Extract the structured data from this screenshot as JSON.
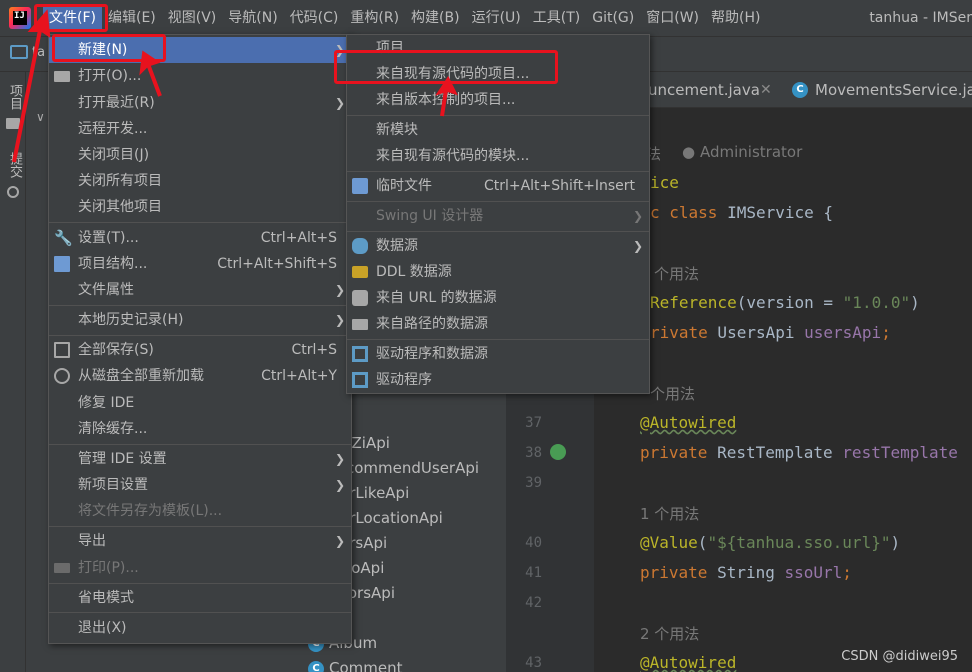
{
  "menubar": {
    "logo_text": "IJ",
    "items": [
      "文件(F)",
      "编辑(E)",
      "视图(V)",
      "导航(N)",
      "代码(C)",
      "重构(R)",
      "构建(B)",
      "运行(U)",
      "工具(T)",
      "Git(G)",
      "窗口(W)",
      "帮助(H)"
    ],
    "title": "tanhua - IMSer"
  },
  "toolbar": {
    "label": "ta"
  },
  "left_strip": {
    "project": "项目",
    "commit": "提交"
  },
  "file_menu": {
    "items": [
      {
        "label": "新建(N)",
        "shortcut": "",
        "submenu": true
      },
      {
        "label": "打开(O)...",
        "shortcut": ""
      },
      {
        "label": "打开最近(R)",
        "shortcut": "",
        "submenu": true
      },
      {
        "label": "远程开发...",
        "shortcut": ""
      },
      {
        "label": "关闭项目(J)",
        "shortcut": ""
      },
      {
        "label": "关闭所有项目",
        "shortcut": ""
      },
      {
        "label": "关闭其他项目",
        "shortcut": ""
      },
      {
        "label": "设置(T)...",
        "shortcut": "Ctrl+Alt+S"
      },
      {
        "label": "项目结构...",
        "shortcut": "Ctrl+Alt+Shift+S"
      },
      {
        "label": "文件属性",
        "shortcut": "",
        "submenu": true
      },
      {
        "label": "本地历史记录(H)",
        "shortcut": "",
        "submenu": true
      },
      {
        "label": "全部保存(S)",
        "shortcut": "Ctrl+S"
      },
      {
        "label": "从磁盘全部重新加载",
        "shortcut": "Ctrl+Alt+Y"
      },
      {
        "label": "修复 IDE",
        "shortcut": ""
      },
      {
        "label": "清除缓存...",
        "shortcut": ""
      },
      {
        "label": "管理 IDE 设置",
        "shortcut": "",
        "submenu": true
      },
      {
        "label": "新项目设置",
        "shortcut": "",
        "submenu": true
      },
      {
        "label": "将文件另存为模板(L)...",
        "shortcut": ""
      },
      {
        "label": "导出",
        "shortcut": "",
        "submenu": true
      },
      {
        "label": "打印(P)...",
        "shortcut": ""
      },
      {
        "label": "省电模式",
        "shortcut": ""
      },
      {
        "label": "退出(X)",
        "shortcut": ""
      }
    ]
  },
  "new_submenu": {
    "items": [
      {
        "label": "项目..."
      },
      {
        "label": "来自现有源代码的项目..."
      },
      {
        "label": "来自版本控制的项目..."
      },
      {
        "label": "新模块"
      },
      {
        "label": "来自现有源代码的模块..."
      },
      {
        "label": "临时文件",
        "shortcut": "Ctrl+Alt+Shift+Insert"
      },
      {
        "label": "Swing UI 设计器"
      },
      {
        "label": "数据源"
      },
      {
        "label": "DDL 数据源"
      },
      {
        "label": "来自 URL 的数据源"
      },
      {
        "label": "来自路径的数据源"
      },
      {
        "label": "驱动程序和数据源"
      },
      {
        "label": "驱动程序"
      }
    ]
  },
  "project_tree": {
    "items": [
      "nZiApi",
      "commendUserApi",
      "erLikeApi",
      "erLocationApi",
      "ersApi",
      "eoApi",
      "torsApi",
      "Album",
      "Comment"
    ]
  },
  "tabs": [
    {
      "label": "uncement.java"
    },
    {
      "label": "MovementsService.jav"
    }
  ],
  "editor": {
    "line_numbers": [
      "37",
      "38",
      "39",
      "40",
      "41",
      "42",
      "43"
    ],
    "author_hint": "法",
    "author": "Administrator",
    "usage_1": "个用法",
    "usage_2": "个用法",
    "usage_3": "1 个用法",
    "usage_4": "2 个用法",
    "line_ice": "ice",
    "line_class_kw": "c class",
    "line_class_name": " IMService {",
    "line_ref_ann": "Reference",
    "line_ref_rest": "(version = ",
    "line_ref_str": "\"1.0.0\"",
    "line_ref_end": ")",
    "line_users_kw": "rivate",
    "line_users_type": " UsersApi ",
    "line_users_fld": "usersApi",
    "line_users_end": ";",
    "autowired": "@Autowired",
    "private_kw": "private",
    "rest_type": " RestTemplate ",
    "rest_fld": "restTemplate",
    "value_ann": "@Value",
    "value_open": "(",
    "value_str": "\"${tanhua.sso.url}\"",
    "value_close": ")",
    "sso_type": " String ",
    "sso_fld": "ssoUrl",
    "sso_end": ";"
  },
  "watermark": "CSDN @didiwei95"
}
